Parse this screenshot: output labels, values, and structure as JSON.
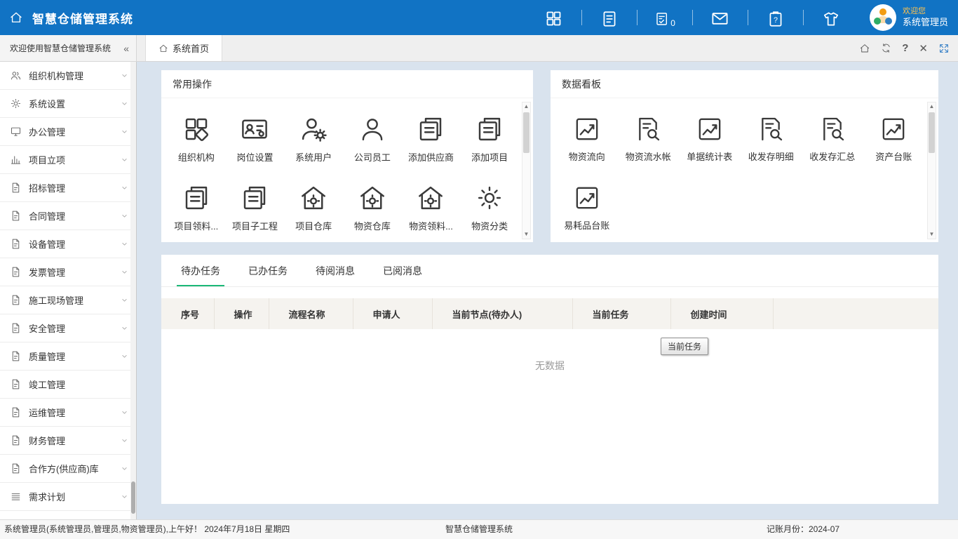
{
  "header": {
    "title": "智慧仓储管理系统",
    "todo_badge": "0",
    "welcome": "欢迎您",
    "username": "系统管理员"
  },
  "subbar": {
    "sidebar_title": "欢迎使用智慧仓储管理系统",
    "collapse_glyph": "«",
    "tab_home": "系统首页"
  },
  "icons": {
    "header": [
      "apps-grid-icon",
      "document-icon",
      "todo-check-icon",
      "mail-icon",
      "clipboard-question-icon",
      "theme-shirt-icon"
    ],
    "tab_tools": [
      "home-icon",
      "refresh-icon",
      "help-icon",
      "close-icon",
      "fullscreen-icon"
    ]
  },
  "sidebar": {
    "items": [
      {
        "label": "组织机构管理"
      },
      {
        "label": "系统设置"
      },
      {
        "label": "办公管理"
      },
      {
        "label": "项目立项"
      },
      {
        "label": "招标管理"
      },
      {
        "label": "合同管理"
      },
      {
        "label": "设备管理"
      },
      {
        "label": "发票管理"
      },
      {
        "label": "施工现场管理"
      },
      {
        "label": "安全管理"
      },
      {
        "label": "质量管理"
      },
      {
        "label": "竣工管理"
      },
      {
        "label": "运维管理"
      },
      {
        "label": "财务管理"
      },
      {
        "label": "合作方(供应商)库"
      },
      {
        "label": "需求计划"
      }
    ]
  },
  "panels": {
    "common": {
      "title": "常用操作",
      "items": [
        {
          "label": "组织机构"
        },
        {
          "label": "岗位设置"
        },
        {
          "label": "系统用户"
        },
        {
          "label": "公司员工"
        },
        {
          "label": "添加供应商"
        },
        {
          "label": "添加项目"
        },
        {
          "label": "项目领料..."
        },
        {
          "label": "项目子工程"
        },
        {
          "label": "项目仓库"
        },
        {
          "label": "物资仓库"
        },
        {
          "label": "物资领料..."
        },
        {
          "label": "物资分类"
        }
      ]
    },
    "dashboard": {
      "title": "数据看板",
      "items": [
        {
          "label": "物资流向"
        },
        {
          "label": "物资流水帐"
        },
        {
          "label": "单据统计表"
        },
        {
          "label": "收发存明细"
        },
        {
          "label": "收发存汇总"
        },
        {
          "label": "资产台账"
        },
        {
          "label": "易耗品台账"
        }
      ]
    }
  },
  "tasks": {
    "tabs": [
      {
        "label": "待办任务"
      },
      {
        "label": "已办任务"
      },
      {
        "label": "待阅消息"
      },
      {
        "label": "已阅消息"
      }
    ],
    "columns": [
      {
        "label": "序号"
      },
      {
        "label": "操作"
      },
      {
        "label": "流程名称"
      },
      {
        "label": "申请人"
      },
      {
        "label": "当前节点(待办人)"
      },
      {
        "label": "当前任务"
      },
      {
        "label": "创建时间"
      }
    ],
    "empty_text": "无数据",
    "tooltip": "当前任务"
  },
  "statusbar": {
    "left": "系统管理员(系统管理员,管理员,物资管理员),上午好！ 2024年7月18日 星期四",
    "center": "智慧仓储管理系统",
    "right": "记账月份：2024-07"
  },
  "colors": {
    "header_bg": "#1173c4",
    "accent_green": "#1bb877",
    "welcome_orange": "#ffc24d",
    "main_bg": "#d9e3ee",
    "table_header_bg": "#f5f3ef"
  }
}
